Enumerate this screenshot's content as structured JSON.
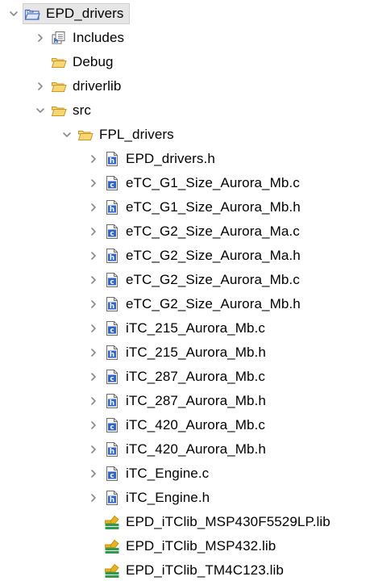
{
  "tree": {
    "items": [
      {
        "label": "EPD_drivers",
        "icon": "ccs-project-icon",
        "state": "expanded",
        "depth": 0,
        "selected": true
      },
      {
        "label": "Includes",
        "icon": "includes-icon",
        "state": "collapsed",
        "depth": 1
      },
      {
        "label": "Debug",
        "icon": "folder-open-icon",
        "state": "none",
        "depth": 1
      },
      {
        "label": "driverlib",
        "icon": "folder-open-icon",
        "state": "collapsed",
        "depth": 1
      },
      {
        "label": "src",
        "icon": "folder-open-icon",
        "state": "expanded",
        "depth": 1
      },
      {
        "label": "FPL_drivers",
        "icon": "folder-open-icon",
        "state": "expanded",
        "depth": 2
      },
      {
        "label": "EPD_drivers.h",
        "icon": "h-file-icon",
        "state": "collapsed",
        "depth": 3
      },
      {
        "label": "eTC_G1_Size_Aurora_Mb.c",
        "icon": "c-file-icon",
        "state": "collapsed",
        "depth": 3
      },
      {
        "label": "eTC_G1_Size_Aurora_Mb.h",
        "icon": "h-file-icon",
        "state": "collapsed",
        "depth": 3
      },
      {
        "label": "eTC_G2_Size_Aurora_Ma.c",
        "icon": "c-file-icon",
        "state": "collapsed",
        "depth": 3
      },
      {
        "label": "eTC_G2_Size_Aurora_Ma.h",
        "icon": "h-file-icon",
        "state": "collapsed",
        "depth": 3
      },
      {
        "label": "eTC_G2_Size_Aurora_Mb.c",
        "icon": "c-file-icon",
        "state": "collapsed",
        "depth": 3
      },
      {
        "label": "eTC_G2_Size_Aurora_Mb.h",
        "icon": "h-file-icon",
        "state": "collapsed",
        "depth": 3
      },
      {
        "label": "iTC_215_Aurora_Mb.c",
        "icon": "c-file-icon",
        "state": "collapsed",
        "depth": 3
      },
      {
        "label": "iTC_215_Aurora_Mb.h",
        "icon": "h-file-icon",
        "state": "collapsed",
        "depth": 3
      },
      {
        "label": "iTC_287_Aurora_Mb.c",
        "icon": "c-file-icon",
        "state": "collapsed",
        "depth": 3
      },
      {
        "label": "iTC_287_Aurora_Mb.h",
        "icon": "h-file-icon",
        "state": "collapsed",
        "depth": 3
      },
      {
        "label": "iTC_420_Aurora_Mb.c",
        "icon": "c-file-icon",
        "state": "collapsed",
        "depth": 3
      },
      {
        "label": "iTC_420_Aurora_Mb.h",
        "icon": "h-file-icon",
        "state": "collapsed",
        "depth": 3
      },
      {
        "label": "iTC_Engine.c",
        "icon": "c-file-icon",
        "state": "collapsed",
        "depth": 3
      },
      {
        "label": "iTC_Engine.h",
        "icon": "h-file-icon",
        "state": "collapsed",
        "depth": 3
      },
      {
        "label": "EPD_iTClib_MSP430F5529LP.lib",
        "icon": "library-file-icon",
        "state": "none",
        "depth": 3
      },
      {
        "label": "EPD_iTClib_MSP432.lib",
        "icon": "library-file-icon",
        "state": "none",
        "depth": 3
      },
      {
        "label": "EPD_iTClib_TM4C123.lib",
        "icon": "library-file-icon",
        "state": "none",
        "depth": 3
      }
    ]
  },
  "colors": {
    "twisty": "#8a8a8a",
    "folder_fill": "#f7d774",
    "folder_stroke": "#c9962b",
    "file_blue": "#2f63c9",
    "lib_green": "#2e9a4e",
    "lib_yellow": "#e8b21e",
    "selection_bg": "#e6e6e6"
  }
}
